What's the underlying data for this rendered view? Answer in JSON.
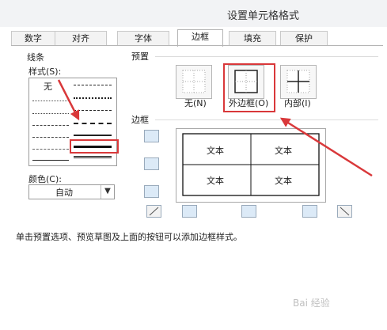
{
  "window": {
    "title": "设置单元格格式"
  },
  "tabs": [
    {
      "label": "数字"
    },
    {
      "label": "对齐"
    },
    {
      "label": "字体"
    },
    {
      "label": "边框"
    },
    {
      "label": "填充"
    },
    {
      "label": "保护"
    }
  ],
  "line_group": {
    "title": "线条",
    "style_label": "样式(S):",
    "none_label": "无",
    "color_label": "颜色(C):",
    "color_value": "自动"
  },
  "presets": {
    "title": "预置",
    "items": [
      {
        "label": "无(N)",
        "icon": "no-border-icon"
      },
      {
        "label": "外边框(O)",
        "icon": "outline-border-icon"
      },
      {
        "label": "内部(I)",
        "icon": "inside-border-icon"
      }
    ]
  },
  "border_group": {
    "title": "边框",
    "cell_text": [
      "文本",
      "文本",
      "文本",
      "文本"
    ]
  },
  "hint_text": "单击预置选项、预览草图及上面的按钮可以添加边框样式。",
  "watermark": "Bai 经验",
  "colors": {
    "accent": "#d9383a",
    "button_blue": "#dceaf7"
  }
}
